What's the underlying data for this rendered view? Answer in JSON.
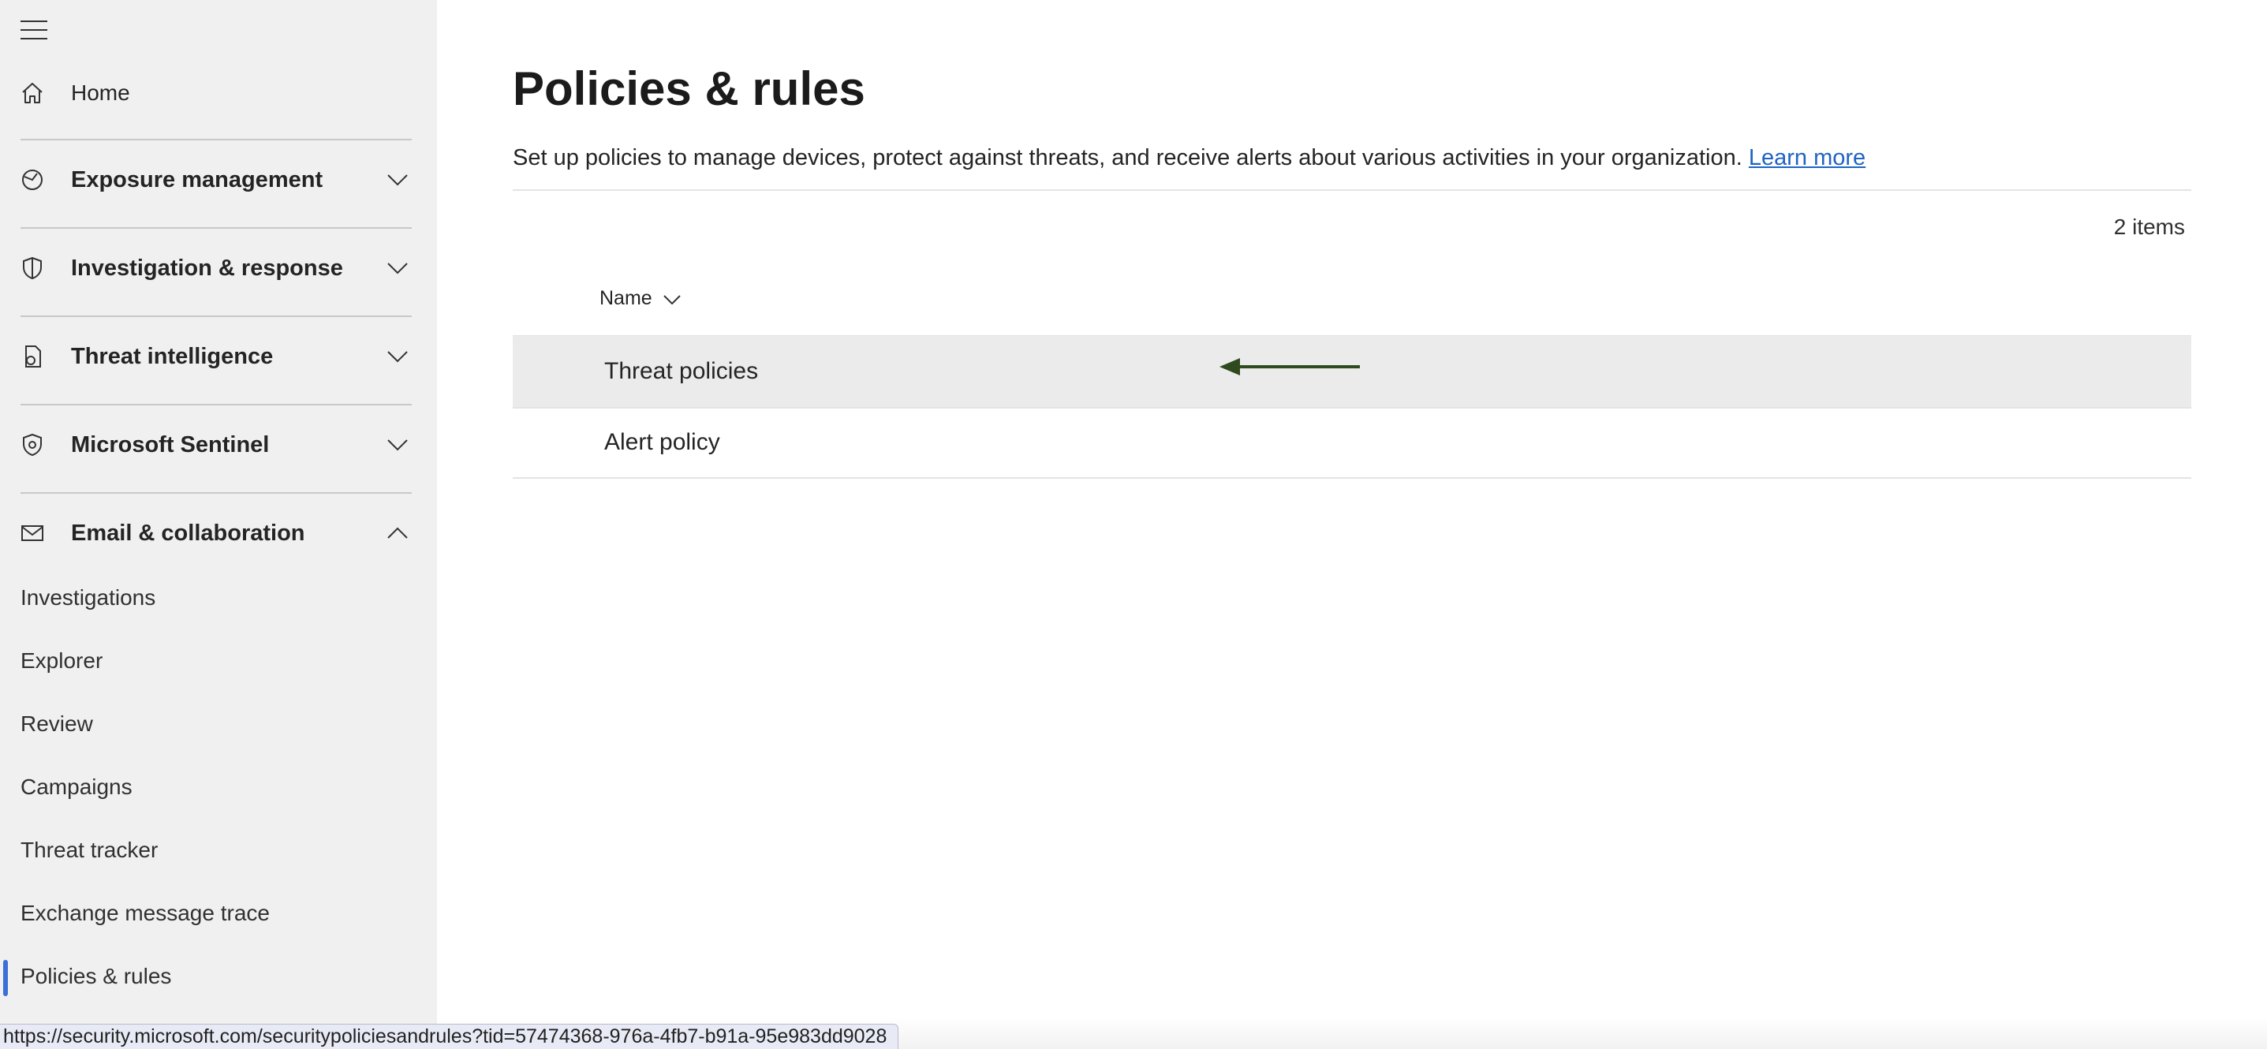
{
  "sidebar": {
    "home": "Home",
    "sections": [
      {
        "label": "Exposure management",
        "icon": "exposure-icon",
        "expanded": false
      },
      {
        "label": "Investigation & response",
        "icon": "shield-icon",
        "expanded": false
      },
      {
        "label": "Threat intelligence",
        "icon": "threat-intel-icon",
        "expanded": false
      },
      {
        "label": "Microsoft Sentinel",
        "icon": "sentinel-icon",
        "expanded": false
      },
      {
        "label": "Email & collaboration",
        "icon": "mail-icon",
        "expanded": true
      }
    ],
    "sub_items": [
      {
        "label": "Investigations"
      },
      {
        "label": "Explorer"
      },
      {
        "label": "Review"
      },
      {
        "label": "Campaigns"
      },
      {
        "label": "Threat tracker"
      },
      {
        "label": "Exchange message trace"
      },
      {
        "label": "Policies & rules",
        "active": true
      }
    ]
  },
  "main": {
    "title": "Policies & rules",
    "description": "Set up policies to manage devices, protect against threats, and receive alerts about various activities in your organization.",
    "learn_more": "Learn more",
    "items_count": "2 items",
    "column_name": "Name",
    "rows": [
      {
        "label": "Threat policies",
        "highlighted": true
      },
      {
        "label": "Alert policy",
        "highlighted": false
      }
    ]
  },
  "status_url": "https://security.microsoft.com/securitypoliciesandrules?tid=57474368-976a-4fb7-b91a-95e983dd9028",
  "colors": {
    "sidebar_bg": "#f0f0f0",
    "accent": "#3a6fd8",
    "link": "#1f63c4",
    "arrow": "#2e4a1e",
    "row_highlight": "#ebebeb"
  }
}
